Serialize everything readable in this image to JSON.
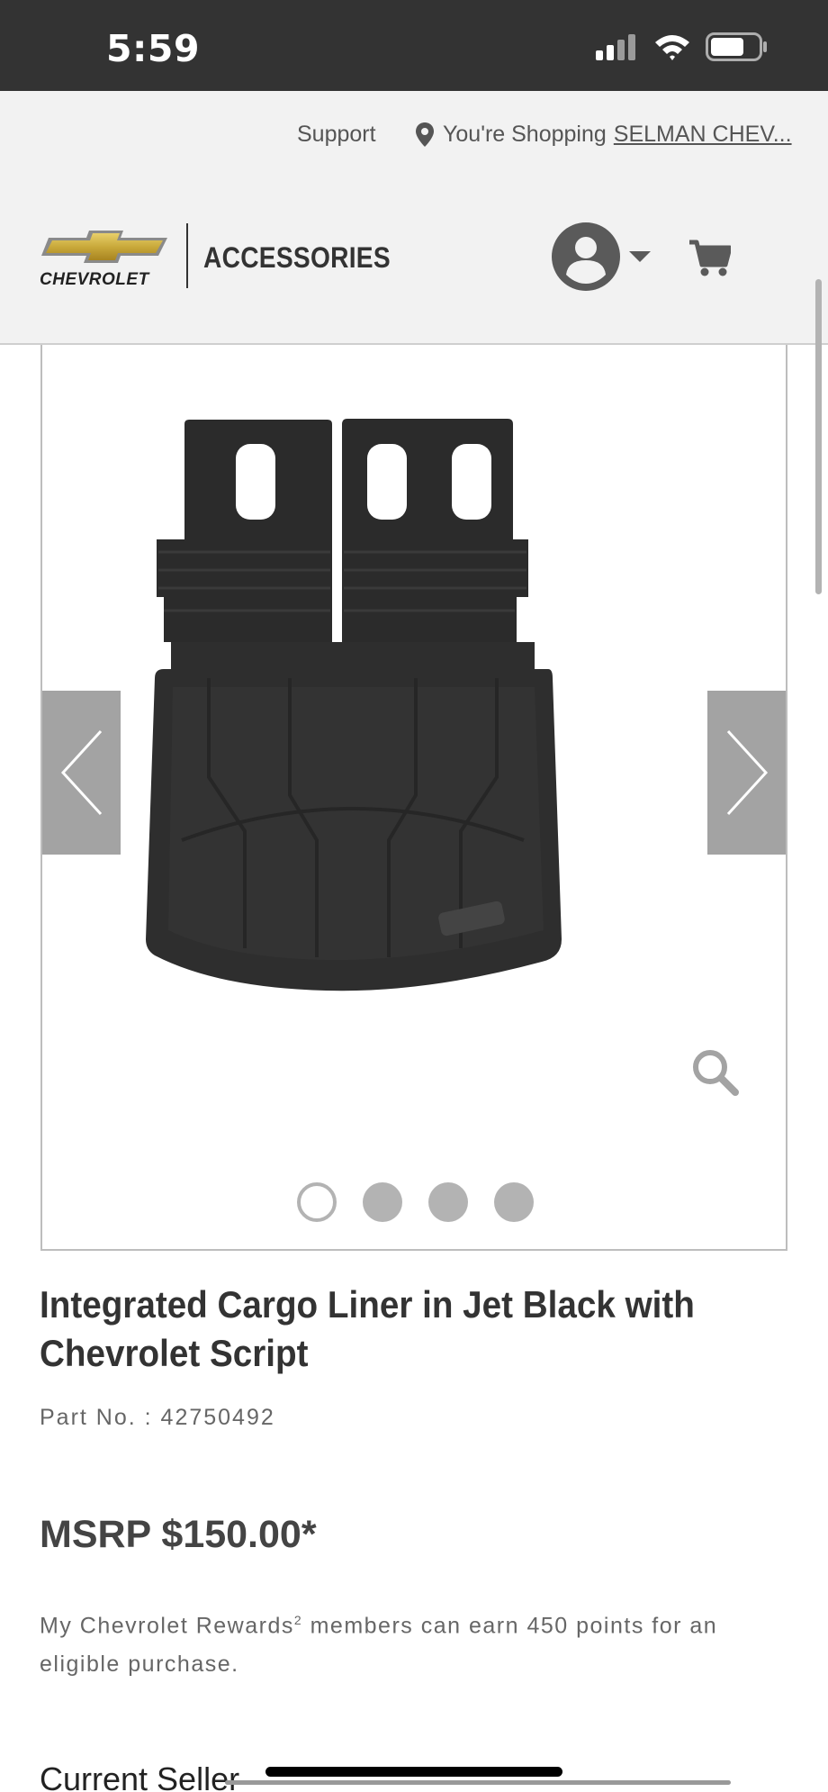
{
  "status_bar": {
    "time": "5:59"
  },
  "utility_bar": {
    "support": "Support",
    "shopping_prefix": "You're Shopping",
    "dealer": "SELMAN CHEV..."
  },
  "header": {
    "brand": "CHEVROLET",
    "section": "ACCESSORIES"
  },
  "gallery": {
    "slide_count": 4,
    "active_slide": 1
  },
  "product": {
    "title_line1": "Integrated Cargo Liner in Jet Black with",
    "title_line2": "Chevrolet Script",
    "part_number": "Part No. : 42750492",
    "msrp": "MSRP $150.00*",
    "rewards_pre": "My Chevrolet Rewards",
    "rewards_sup": "2",
    "rewards_post": " members can earn 450 points for an eligible purchase.",
    "current_seller": "Current Seller"
  },
  "colors": {
    "status_bar": "#333333",
    "header_bg": "#f2f2f2",
    "nav_button": "#a3a3a3",
    "bowtie_gold": "#c9a93b"
  }
}
